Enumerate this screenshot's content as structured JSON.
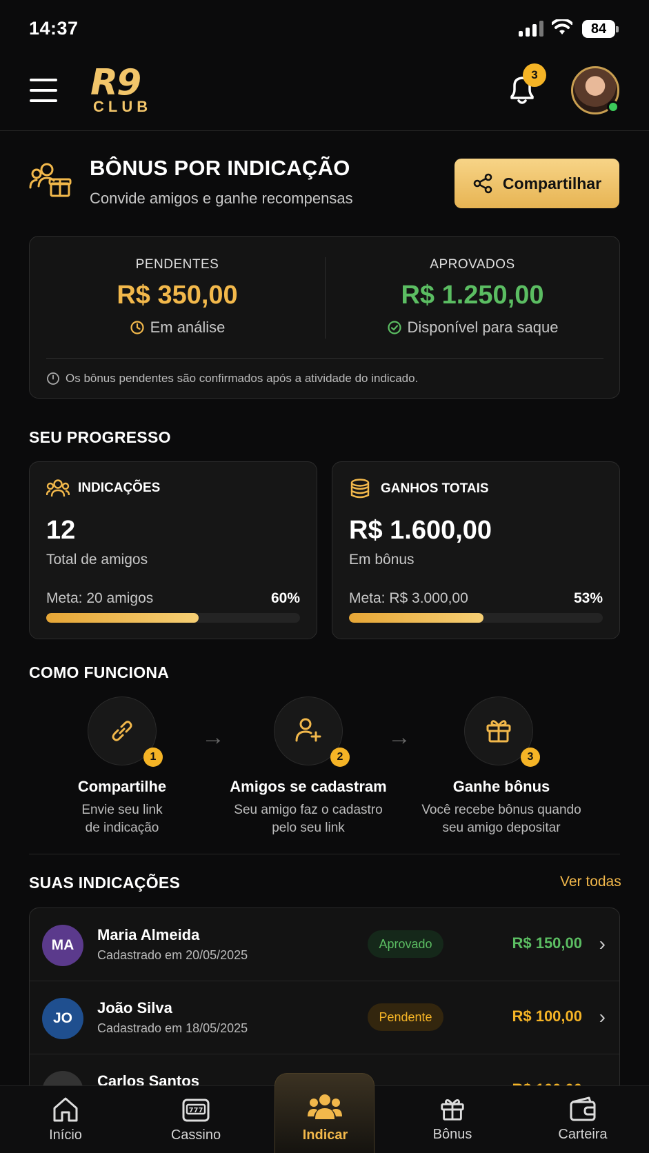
{
  "status_bar": {
    "time": "14:37",
    "battery": "84"
  },
  "header": {
    "logo_top": "R9",
    "logo_bottom": "CLUB",
    "notifications_count": "3"
  },
  "promo": {
    "title": "BÔNUS POR INDICAÇÃO",
    "subtitle": "Convide amigos e ganhe recompensas",
    "share_label": "Compartilhar"
  },
  "summary": {
    "pending": {
      "label": "PENDENTES",
      "value": "R$ 350,00",
      "status": "Em análise"
    },
    "approved": {
      "label": "APROVADOS",
      "value": "R$ 1.250,00",
      "status": "Disponível para saque"
    },
    "note": "Os bônus pendentes são confirmados após a atividade do indicado."
  },
  "progress": {
    "section_title": "SEU PROGRESSO",
    "referrals": {
      "title": "INDICAÇÕES",
      "value": "12",
      "caption": "Total de amigos",
      "goal": "Meta: 20 amigos",
      "percent_label": "60%",
      "percent": 60
    },
    "earnings": {
      "title": "GANHOS TOTAIS",
      "value": "R$ 1.600,00",
      "caption": "Em bônus",
      "goal": "Meta: R$ 3.000,00",
      "percent_label": "53%",
      "percent": 53
    }
  },
  "how_it_works": {
    "section_title": "COMO FUNCIONA",
    "steps": [
      {
        "num": "1",
        "title": "Compartilhe",
        "desc_1": "Envie seu link",
        "desc_2": "de indicação",
        "icon": "link-icon"
      },
      {
        "num": "2",
        "title": "Amigos se cadastram",
        "desc_1": "Seu amigo faz o cadastro",
        "desc_2": "pelo seu link",
        "icon": "user-plus-icon"
      },
      {
        "num": "3",
        "title": "Ganhe bônus",
        "desc_1": "Você recebe bônus quando",
        "desc_2": "seu amigo depositar",
        "icon": "gift-icon"
      }
    ]
  },
  "referrals": {
    "section_title": "SUAS INDICAÇÕES",
    "see_all": "Ver todas",
    "items": [
      {
        "initials": "MA",
        "name": "Maria Almeida",
        "date": "Cadastrado em 20/05/2025",
        "status": "Aprovado",
        "amount": "R$ 150,00",
        "avatar_color": "#5b3a8c",
        "status_color": "#5bbd62",
        "status_bg": "#15281a",
        "amount_color": "#5bbd62"
      },
      {
        "initials": "JO",
        "name": "João Silva",
        "date": "Cadastrado em 18/05/2025",
        "status": "Pendente",
        "amount": "R$ 100,00",
        "avatar_color": "#1f4f8f",
        "status_color": "#f5b426",
        "status_bg": "#33260e",
        "amount_color": "#f5b426"
      },
      {
        "initials": "",
        "name": "Carlos Santos",
        "date": "",
        "status": "",
        "amount": "R$ 100,00",
        "avatar_color": "#333333",
        "status_color": "#f5b426",
        "status_bg": "#222",
        "amount_color": "#f5b426"
      }
    ]
  },
  "bottom_nav": [
    {
      "label": "Início",
      "icon": "home-icon"
    },
    {
      "label": "Cassino",
      "icon": "slot-machine-icon"
    },
    {
      "label": "Indicar",
      "icon": "users-icon"
    },
    {
      "label": "Bônus",
      "icon": "gift-icon"
    },
    {
      "label": "Carteira",
      "icon": "wallet-icon"
    }
  ],
  "colors": {
    "accent": "#f2b84b",
    "approved": "#5bbd62",
    "background": "#0b0b0c"
  }
}
